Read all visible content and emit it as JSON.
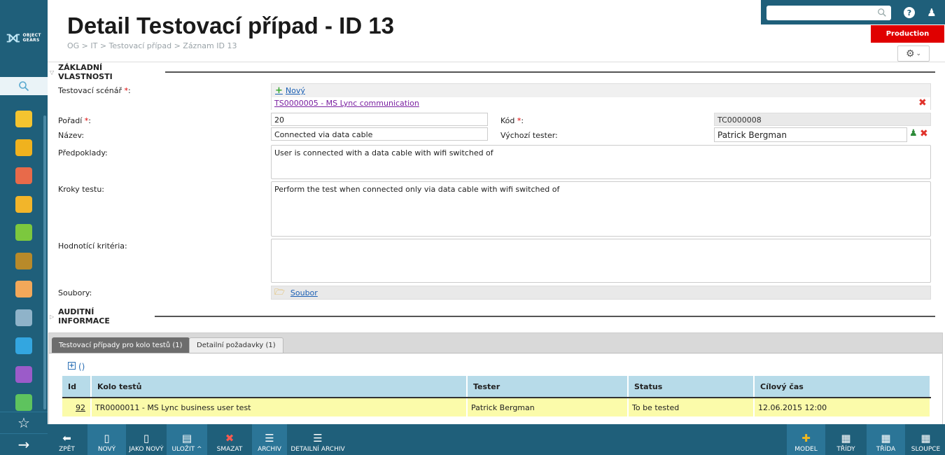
{
  "sidebar": {
    "logo": {
      "line1": "OBJECT",
      "line2": "GEARS"
    },
    "icons": [
      {
        "name": "folder-icon",
        "color": "#f4c430"
      },
      {
        "name": "badge-icon",
        "color": "#f0b21e"
      },
      {
        "name": "tag-icon",
        "color": "#e86a4a"
      },
      {
        "name": "boxes-icon",
        "color": "#f2b52a"
      },
      {
        "name": "cube-icon",
        "color": "#7cc83e"
      },
      {
        "name": "traffic-light-icon",
        "color": "#b88a2a"
      },
      {
        "name": "user-icon",
        "color": "#f2a85a"
      },
      {
        "name": "tools-icon",
        "color": "#8fb3c9"
      },
      {
        "name": "shuttle-icon",
        "color": "#33a6e0"
      },
      {
        "name": "screen-icon",
        "color": "#9b5bc9"
      },
      {
        "name": "network-icon",
        "color": "#5ec35e"
      }
    ],
    "bottom": {
      "star": "☆",
      "arrow": "→"
    }
  },
  "header": {
    "title": "Detail Testovací případ - ID 13",
    "breadcrumb": "OG > IT > Testovací případ > Záznam ID 13",
    "environment": "Production",
    "help": "?"
  },
  "sections": {
    "basic": "ZÁKLADNÍ VLASTNOSTI",
    "audit": "AUDITNÍ INFORMACE"
  },
  "form": {
    "scenario_label": "Testovací scénář ",
    "required_mark": "*",
    "colon": ":",
    "new_link": "Nový",
    "scenario_value": "TS0000005 - MS Lync communication",
    "order_label": "Pořadí ",
    "order_value": "20",
    "code_label": "Kód ",
    "code_value": "TC0000008",
    "name_label": "Název:",
    "name_value": "Connected via data cable",
    "tester_label": "Výchozí tester:",
    "tester_value": "Patrick Bergman",
    "prereq_label": "Předpoklady:",
    "prereq_value": "User is connected with a data cable with wifi switched of",
    "steps_label": "Kroky testu:",
    "steps_value": "Perform the test when connected only via data cable with wifi switched of",
    "criteria_label": "Hodnotící kritéria:",
    "criteria_value": "",
    "files_label": "Soubory:",
    "files_link": "Soubor"
  },
  "tabs": [
    {
      "label": "Testovací případy pro kolo testů (1)"
    },
    {
      "label": "Detailní požadavky (1)"
    }
  ],
  "grid": {
    "columns": [
      "Id",
      "Kolo testů",
      "Tester",
      "Status",
      "Cílový čas"
    ],
    "rows": [
      {
        "id": "92",
        "round": "TR0000011 - MS Lync business user test",
        "tester": "Patrick Bergman",
        "status": "To be tested",
        "target": "12.06.2015 12:00"
      }
    ]
  },
  "toolbar": {
    "back": "ZPĚT",
    "new": "NOVÝ",
    "as_new": "JAKO NOVÝ",
    "save": "ULOŽIT",
    "delete": "SMAZAT",
    "archive": "ARCHIV",
    "detail_archive": "DETAILNÍ ARCHIV",
    "model": "MODEL",
    "classes": "TŘÍDY",
    "class": "TŘÍDA",
    "columns": "SLOUPCE"
  },
  "colors": {
    "brand": "#1f5f7a",
    "env_badge": "#e00000",
    "grid_header": "#b7dbe9",
    "row_highlight": "#fbfbaa"
  }
}
